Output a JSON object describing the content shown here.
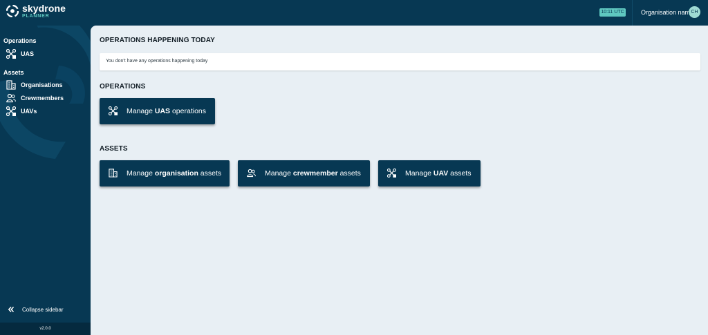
{
  "app": {
    "brand": "skydrone",
    "product": "PLANNER"
  },
  "header": {
    "time": "10:11 UTC",
    "organisation_name": "Organisation name",
    "avatar_initials": "CH"
  },
  "sidebar": {
    "sections": [
      {
        "heading": "Operations",
        "items": [
          {
            "label": "UAS",
            "icon": "drone-icon"
          }
        ]
      },
      {
        "heading": "Assets",
        "items": [
          {
            "label": "Organisations",
            "icon": "building-icon"
          },
          {
            "label": "Crewmembers",
            "icon": "people-icon"
          },
          {
            "label": "UAVs",
            "icon": "drone-icon"
          }
        ]
      }
    ],
    "collapse_label": "Collapse sidebar",
    "collapse_icon": "double-chevron-left-icon",
    "version": "v2.0.0"
  },
  "main": {
    "today_title": "OPERATIONS HAPPENING TODAY",
    "today_empty": "You don't have any operations happening today",
    "operations_title": "OPERATIONS",
    "operations_buttons": [
      {
        "prefix": "Manage ",
        "bold": "UAS",
        "suffix": " operations",
        "icon": "drone-icon"
      }
    ],
    "assets_title": "ASSETS",
    "assets_buttons": [
      {
        "prefix": "Manage ",
        "bold": "organisation",
        "suffix": " assets",
        "icon": "building-icon"
      },
      {
        "prefix": "Manage ",
        "bold": "crewmember",
        "suffix": " assets",
        "icon": "people-icon"
      },
      {
        "prefix": "Manage ",
        "bold": "UAV",
        "suffix": " assets",
        "icon": "drone-icon"
      }
    ]
  },
  "colors": {
    "navy": "#073853",
    "teal": "#5fc8c0",
    "background": "#e8eff4"
  }
}
